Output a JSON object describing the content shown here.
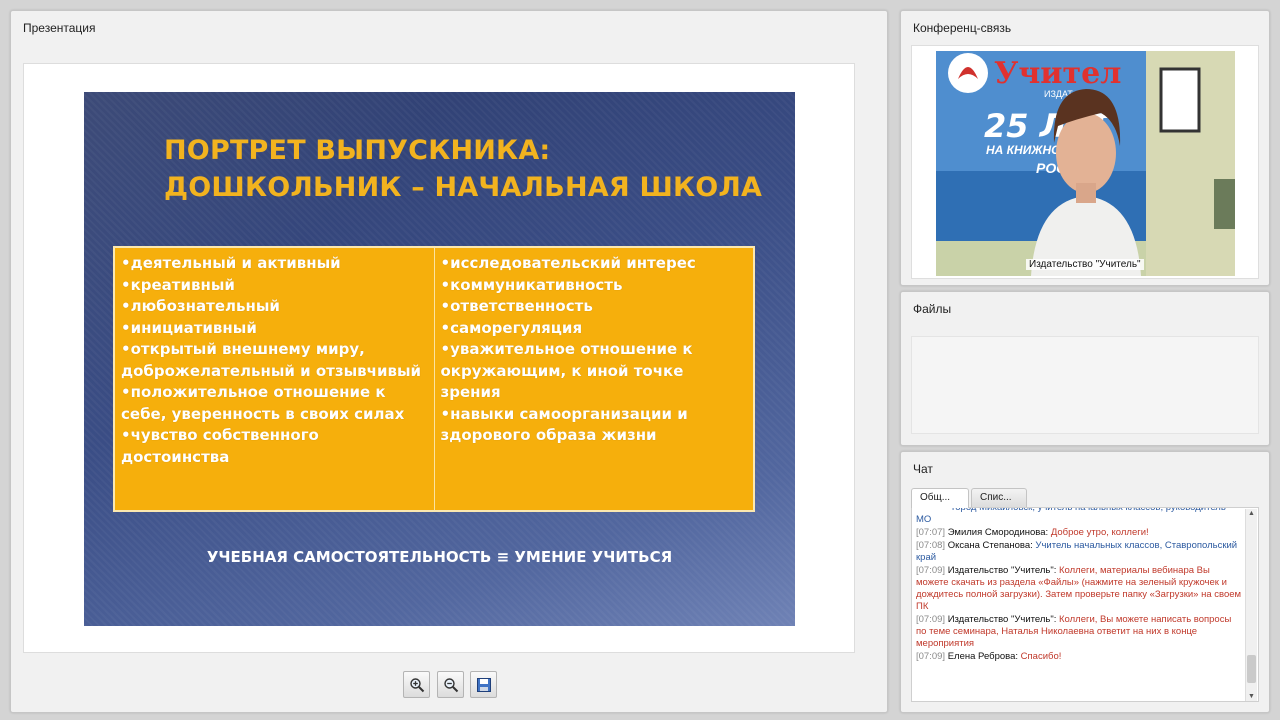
{
  "presentation": {
    "title": "Презентация",
    "slide": {
      "title": "ПОРТРЕТ ВЫПУСКНИКА:\nДОШКОЛЬНИК – НАЧАЛЬНАЯ ШКОЛА",
      "left_items": [
        "•деятельный и активный",
        "•креативный",
        "•любознательный",
        "•инициативный",
        "•открытый внешнему миру, доброжелательный и отзывчивый",
        "•положительное отношение к себе, уверенность в своих силах",
        "•чувство собственного достоинства"
      ],
      "right_items": [
        "•исследовательский интерес",
        "•коммуникативность",
        "•ответственность",
        "•саморегуляция",
        "•уважительное отношение к окружающим, к иной точке зрения",
        "•навыки самоорганизации и здорового образа жизни"
      ],
      "footer": "УЧЕБНАЯ САМОСТОЯТЕЛЬНОСТЬ ≡ УМЕНИЕ УЧИТЬСЯ"
    },
    "toolbar": {
      "zoom_in_icon": "zoom-in-icon",
      "zoom_out_icon": "zoom-out-icon",
      "save_icon": "save-icon"
    }
  },
  "video": {
    "title": "Конференц-связь",
    "caption": "Издательство \"Учитель\"",
    "banner_brand": "Учител",
    "banner_sub": "ИЗДАТ",
    "banner_big": "25 ЛЕТ",
    "banner_line1": "НА КНИЖНОМ",
    "banner_line2": "РОСС"
  },
  "files": {
    "title": "Файлы"
  },
  "chat": {
    "title": "Чат",
    "tabs": [
      "Общ...",
      "Спис..."
    ],
    "messages": [
      {
        "time": "",
        "author": "",
        "text": "город Михайловск, учитель начальных классов, руководитель МО",
        "color": "blue"
      },
      {
        "time": "[07:07]",
        "author": "Эмилия Смородинова:",
        "text": "Доброе утро, коллеги!",
        "color": "red"
      },
      {
        "time": "[07:08]",
        "author": "Оксана Степанова:",
        "text": "Учитель начальных классов, Ставропольский край",
        "color": "blue"
      },
      {
        "time": "[07:09]",
        "author": "Издательство \"Учитель\":",
        "text": "Коллеги, материалы вебинара Вы можете скачать из раздела «Файлы» (нажмите на зеленый кружочек и дождитесь полной загрузки). Затем проверьте папку «Загрузки» на своем ПК",
        "color": "red"
      },
      {
        "time": "[07:09]",
        "author": "Издательство \"Учитель\":",
        "text": "Коллеги, Вы можете написать вопросы по теме семинара, Наталья Николаевна ответит на них в конце мероприятия",
        "color": "red"
      },
      {
        "time": "[07:09]",
        "author": "Елена Реброва:",
        "text": "Спасибо!",
        "color": "red"
      }
    ]
  }
}
